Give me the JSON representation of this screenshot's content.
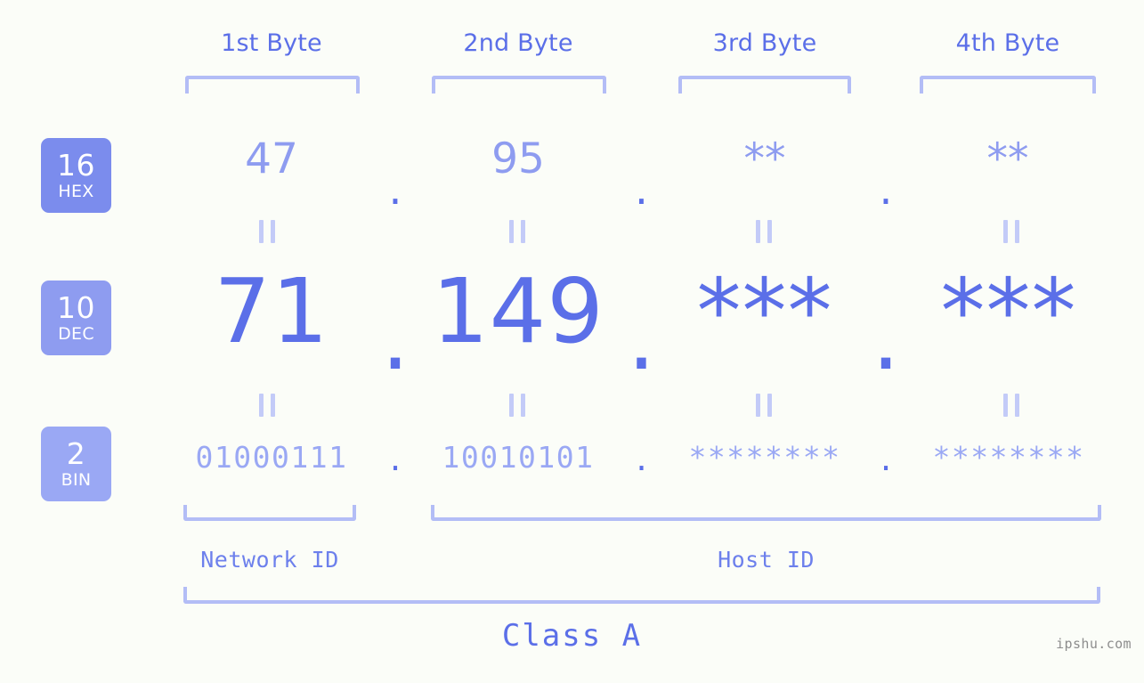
{
  "watermark": "ipshu.com",
  "byte_headers": [
    {
      "label": "1st Byte"
    },
    {
      "label": "2nd Byte"
    },
    {
      "label": "3rd Byte"
    },
    {
      "label": "4th Byte"
    }
  ],
  "bases": [
    {
      "number": "16",
      "name": "HEX",
      "color": "#7b8ced"
    },
    {
      "number": "10",
      "name": "DEC",
      "color": "#8e9cf0"
    },
    {
      "number": "2",
      "name": "BIN",
      "color": "#9aa8f4"
    }
  ],
  "rows": {
    "hex": {
      "b1": "47",
      "b2": "95",
      "b3": "**",
      "b4": "**",
      "sep": "."
    },
    "dec": {
      "b1": "71",
      "b2": "149",
      "b3": "***",
      "b4": "***",
      "sep": "."
    },
    "bin": {
      "b1": "01000111",
      "b2": "10010101",
      "b3": "********",
      "b4": "********",
      "sep": "."
    }
  },
  "sections": {
    "network_id": "Network ID",
    "host_id": "Host ID",
    "class": "Class A"
  },
  "colors": {
    "accent": "#5b6fe8",
    "accent_light": "#9aa8f4",
    "bracket": "#b3bdf6",
    "background": "#fbfdf8"
  }
}
